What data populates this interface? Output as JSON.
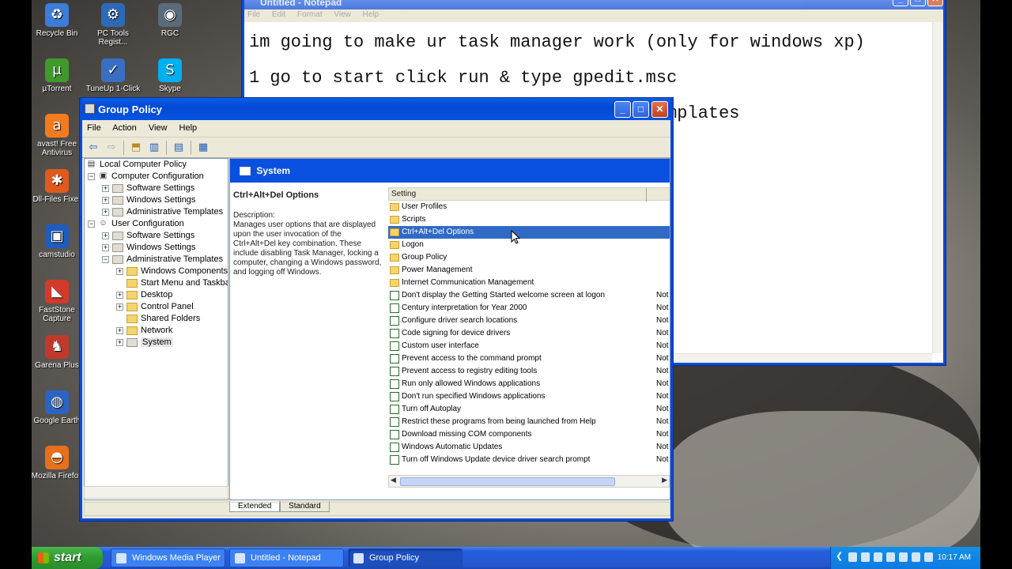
{
  "desktop_icons": [
    {
      "label": "Recycle Bin",
      "glyph": "♻",
      "color": "#3b7dd8"
    },
    {
      "label": "PC Tools Regist...",
      "glyph": "⚙",
      "color": "#2c6ab8"
    },
    {
      "label": "RGC",
      "glyph": "◉",
      "color": "#5a6b7a"
    },
    {
      "label": "µTorrent",
      "glyph": "µ",
      "color": "#3f9a2b"
    },
    {
      "label": "TuneUp 1-Click",
      "glyph": "✓",
      "color": "#3a6ec2"
    },
    {
      "label": "Skype",
      "glyph": "S",
      "color": "#00aff0"
    },
    {
      "label": "avast! Free Antivirus",
      "glyph": "a",
      "color": "#f27b20"
    },
    {
      "label": "Dll-Files Fixer",
      "glyph": "✱",
      "color": "#e05a1e"
    },
    {
      "label": "camstudio",
      "glyph": "▣",
      "color": "#1f5cbf"
    },
    {
      "label": "FastStone Capture",
      "glyph": "◣",
      "color": "#d43a2a"
    },
    {
      "label": "Garena Plus",
      "glyph": "♞",
      "color": "#c0392b"
    },
    {
      "label": "Google Earth",
      "glyph": "◍",
      "color": "#2b63c0"
    },
    {
      "label": "Mozilla Firefox",
      "glyph": "◓",
      "color": "#e8701a"
    }
  ],
  "notepad": {
    "title": "Untitled - Notepad",
    "menu": [
      "File",
      "Edit",
      "Format",
      "View",
      "Help"
    ],
    "lines": [
      "im going to make ur task manager work (only for windows xp)",
      "1 go to start click run & type gpedit.msc",
      "                                       emplates"
    ]
  },
  "group_policy": {
    "title": "Group Policy",
    "menu": [
      "File",
      "Action",
      "View",
      "Help"
    ],
    "tree": [
      "Local Computer Policy",
      "Computer Configuration",
      "Software Settings",
      "Windows Settings",
      "Administrative Templates",
      "User Configuration",
      "Software Settings",
      "Windows Settings",
      "Administrative Templates",
      "Windows Components",
      "Start Menu and Taskbar",
      "Desktop",
      "Control Panel",
      "Shared Folders",
      "Network",
      "System"
    ],
    "header": "System",
    "description": {
      "title": "Ctrl+Alt+Del Options",
      "label": "Description:",
      "text": "Manages user options that are displayed upon the user invocation of the Ctrl+Alt+Del key combination. These include disabling Task Manager, locking a computer, changing a Windows password, and logging off Windows."
    },
    "column_header": "Setting",
    "items": [
      {
        "label": "User Profiles",
        "kind": "folder",
        "state": ""
      },
      {
        "label": "Scripts",
        "kind": "folder",
        "state": ""
      },
      {
        "label": "Ctrl+Alt+Del Options",
        "kind": "folder",
        "state": ""
      },
      {
        "label": "Logon",
        "kind": "folder",
        "state": ""
      },
      {
        "label": "Group Policy",
        "kind": "folder",
        "state": ""
      },
      {
        "label": "Power Management",
        "kind": "folder",
        "state": ""
      },
      {
        "label": "Internet Communication Management",
        "kind": "folder",
        "state": ""
      },
      {
        "label": "Don't display the Getting Started welcome screen at logon",
        "kind": "policy",
        "state": "Not"
      },
      {
        "label": "Century interpretation for Year 2000",
        "kind": "policy",
        "state": "Not"
      },
      {
        "label": "Configure driver search locations",
        "kind": "policy",
        "state": "Not"
      },
      {
        "label": "Code signing for device drivers",
        "kind": "policy",
        "state": "Not"
      },
      {
        "label": "Custom user interface",
        "kind": "policy",
        "state": "Not"
      },
      {
        "label": "Prevent access to the command prompt",
        "kind": "policy",
        "state": "Not"
      },
      {
        "label": "Prevent access to registry editing tools",
        "kind": "policy",
        "state": "Not"
      },
      {
        "label": "Run only allowed Windows applications",
        "kind": "policy",
        "state": "Not"
      },
      {
        "label": "Don't run specified Windows applications",
        "kind": "policy",
        "state": "Not"
      },
      {
        "label": "Turn off Autoplay",
        "kind": "policy",
        "state": "Not"
      },
      {
        "label": "Restrict these programs from being launched from Help",
        "kind": "policy",
        "state": "Not"
      },
      {
        "label": "Download missing COM components",
        "kind": "policy",
        "state": "Not"
      },
      {
        "label": "Windows Automatic Updates",
        "kind": "policy",
        "state": "Not"
      },
      {
        "label": "Turn off Windows Update device driver search prompt",
        "kind": "policy",
        "state": "Not"
      }
    ],
    "tabs": [
      "Extended",
      "Standard"
    ]
  },
  "taskbar": {
    "start": "start",
    "tasks": [
      "Windows Media Player",
      "Untitled - Notepad",
      "Group Policy"
    ],
    "clock": "10:17 AM"
  },
  "colors": {
    "xp_blue": "#0a50e0",
    "selection": "#316ac5",
    "start_green": "#3aa83a"
  }
}
